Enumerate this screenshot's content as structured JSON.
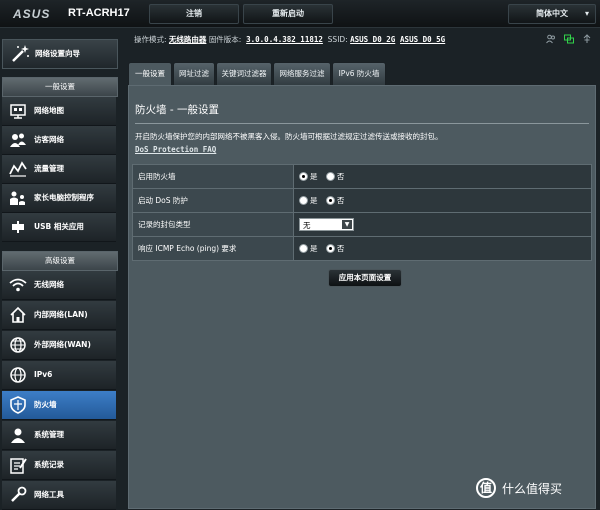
{
  "header": {
    "logo": "ASUS",
    "model": "RT-ACRH17",
    "logout_label": "注销",
    "reboot_label": "重新启动",
    "language_label": "简体中文"
  },
  "info": {
    "mode_label": "操作模式:",
    "mode_value": "无线路由器",
    "firmware_label": "固件版本:",
    "firmware_value": "3.0.0.4.382_11812",
    "ssid_label": "SSID:",
    "ssid_2g": "ASUS_D0_2G",
    "ssid_5g": "ASUS_D0_5G"
  },
  "sidebar": {
    "qis_label": "网络设置向导",
    "general_header": "一般设置",
    "general_items": [
      {
        "label": "网络地图",
        "icon": "network-map-icon"
      },
      {
        "label": "访客网络",
        "icon": "guest-network-icon"
      },
      {
        "label": "流量管理",
        "icon": "traffic-manager-icon"
      },
      {
        "label": "家长电脑控制程序",
        "icon": "parental-control-icon"
      },
      {
        "label": "USB 相关应用",
        "icon": "usb-application-icon"
      }
    ],
    "advanced_header": "高级设置",
    "advanced_items": [
      {
        "label": "无线网络",
        "icon": "wireless-icon"
      },
      {
        "label": "内部网络(LAN)",
        "icon": "lan-icon"
      },
      {
        "label": "外部网络(WAN)",
        "icon": "wan-icon"
      },
      {
        "label": "IPv6",
        "icon": "ipv6-icon"
      },
      {
        "label": "防火墙",
        "icon": "firewall-icon"
      },
      {
        "label": "系统管理",
        "icon": "administration-icon"
      },
      {
        "label": "系统记录",
        "icon": "system-log-icon"
      },
      {
        "label": "网络工具",
        "icon": "network-tools-icon"
      }
    ]
  },
  "tabs": [
    "一般设置",
    "网址过滤",
    "关键词过滤器",
    "网络服务过滤",
    "IPv6 防火墙"
  ],
  "main": {
    "title": "防火墙 - 一般设置",
    "description": "开启防火墙保护您的内部网络不被黑客入侵。防火墙可根据过滤规定过滤传送或接收的封包。",
    "faq_link": "DoS Protection FAQ",
    "rows": [
      {
        "label": "启用防火墙",
        "yes": "是",
        "no": "否",
        "selected": "yes"
      },
      {
        "label": "启动 DoS 防护",
        "yes": "是",
        "no": "否",
        "selected": "no"
      },
      {
        "label": "记录的封包类型",
        "select_value": "无"
      },
      {
        "label": "响应 ICMP Echo (ping) 要求",
        "yes": "是",
        "no": "否",
        "selected": "no"
      }
    ],
    "apply_label": "应用本页面设置"
  },
  "watermark": {
    "symbol": "值",
    "text": "什么值得买"
  },
  "colors": {
    "active_menu": "#3d7ec7",
    "panel_bg": "#4d5a60",
    "status_green": "#32d24a"
  }
}
